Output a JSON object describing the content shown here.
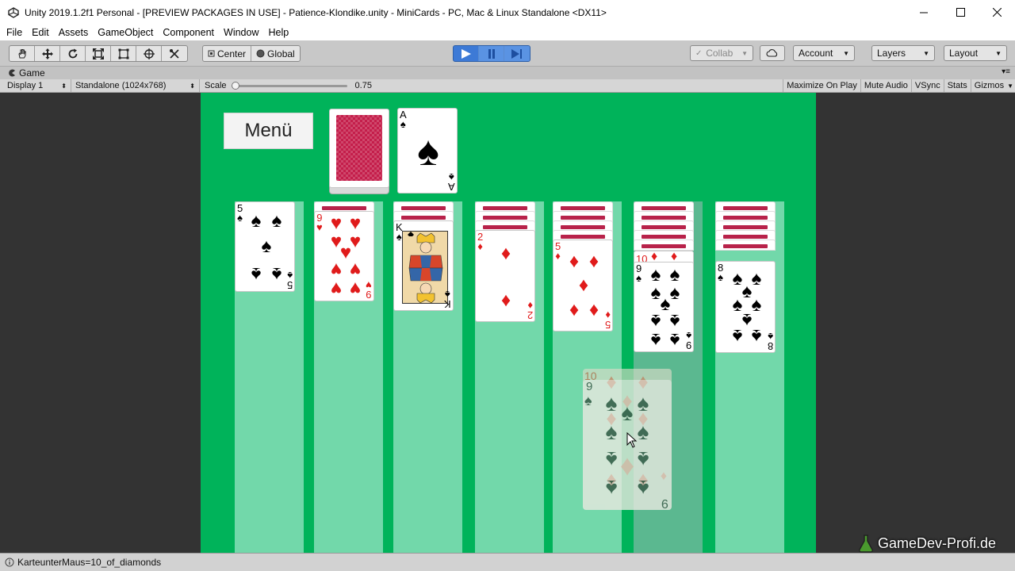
{
  "window": {
    "title": "Unity 2019.1.2f1 Personal - [PREVIEW PACKAGES IN USE] - Patience-Klondike.unity - MiniCards - PC, Mac & Linux Standalone <DX11>"
  },
  "menubar": [
    "File",
    "Edit",
    "Assets",
    "GameObject",
    "Component",
    "Window",
    "Help"
  ],
  "toolbar": {
    "pivot": "Center",
    "space": "Global",
    "collab": "Collab",
    "account": "Account",
    "layers": "Layers",
    "layout": "Layout"
  },
  "game_tab": {
    "label": "Game"
  },
  "game_toolbar": {
    "display": "Display 1",
    "resolution": "Standalone (1024x768)",
    "scale_label": "Scale",
    "scale_value": "0.75",
    "maximize": "Maximize On Play",
    "mute": "Mute Audio",
    "vsync": "VSync",
    "stats": "Stats",
    "gizmos": "Gizmos"
  },
  "game": {
    "menu_button": "Menü",
    "stock": {
      "face_down": true
    },
    "waste": {
      "rank": "A",
      "suit": "♠"
    },
    "tableau": [
      {
        "hidden": 0,
        "face_up": [
          {
            "rank": "5",
            "suit": "♠"
          }
        ]
      },
      {
        "hidden": 1,
        "face_up": [
          {
            "rank": "9",
            "suit": "♥"
          }
        ]
      },
      {
        "hidden": 2,
        "face_up": [
          {
            "rank": "K",
            "suit": "♠"
          }
        ]
      },
      {
        "hidden": 3,
        "face_up": [
          {
            "rank": "2",
            "suit": "♦"
          }
        ]
      },
      {
        "hidden": 4,
        "face_up": [
          {
            "rank": "5",
            "suit": "♦"
          }
        ]
      },
      {
        "hidden": 5,
        "face_up": [
          {
            "rank": "10",
            "suit": "♦"
          },
          {
            "rank": "9",
            "suit": "♠"
          }
        ]
      },
      {
        "hidden": 5,
        "face_up": [
          {
            "rank": "8",
            "suit": "♠"
          }
        ]
      }
    ],
    "dragging": [
      {
        "rank": "10",
        "suit": "♦"
      },
      {
        "rank": "9",
        "suit": "♠"
      }
    ]
  },
  "status": {
    "text": "KarteunterMaus=10_of_diamonds"
  },
  "watermark": "GameDev-Profi.de"
}
